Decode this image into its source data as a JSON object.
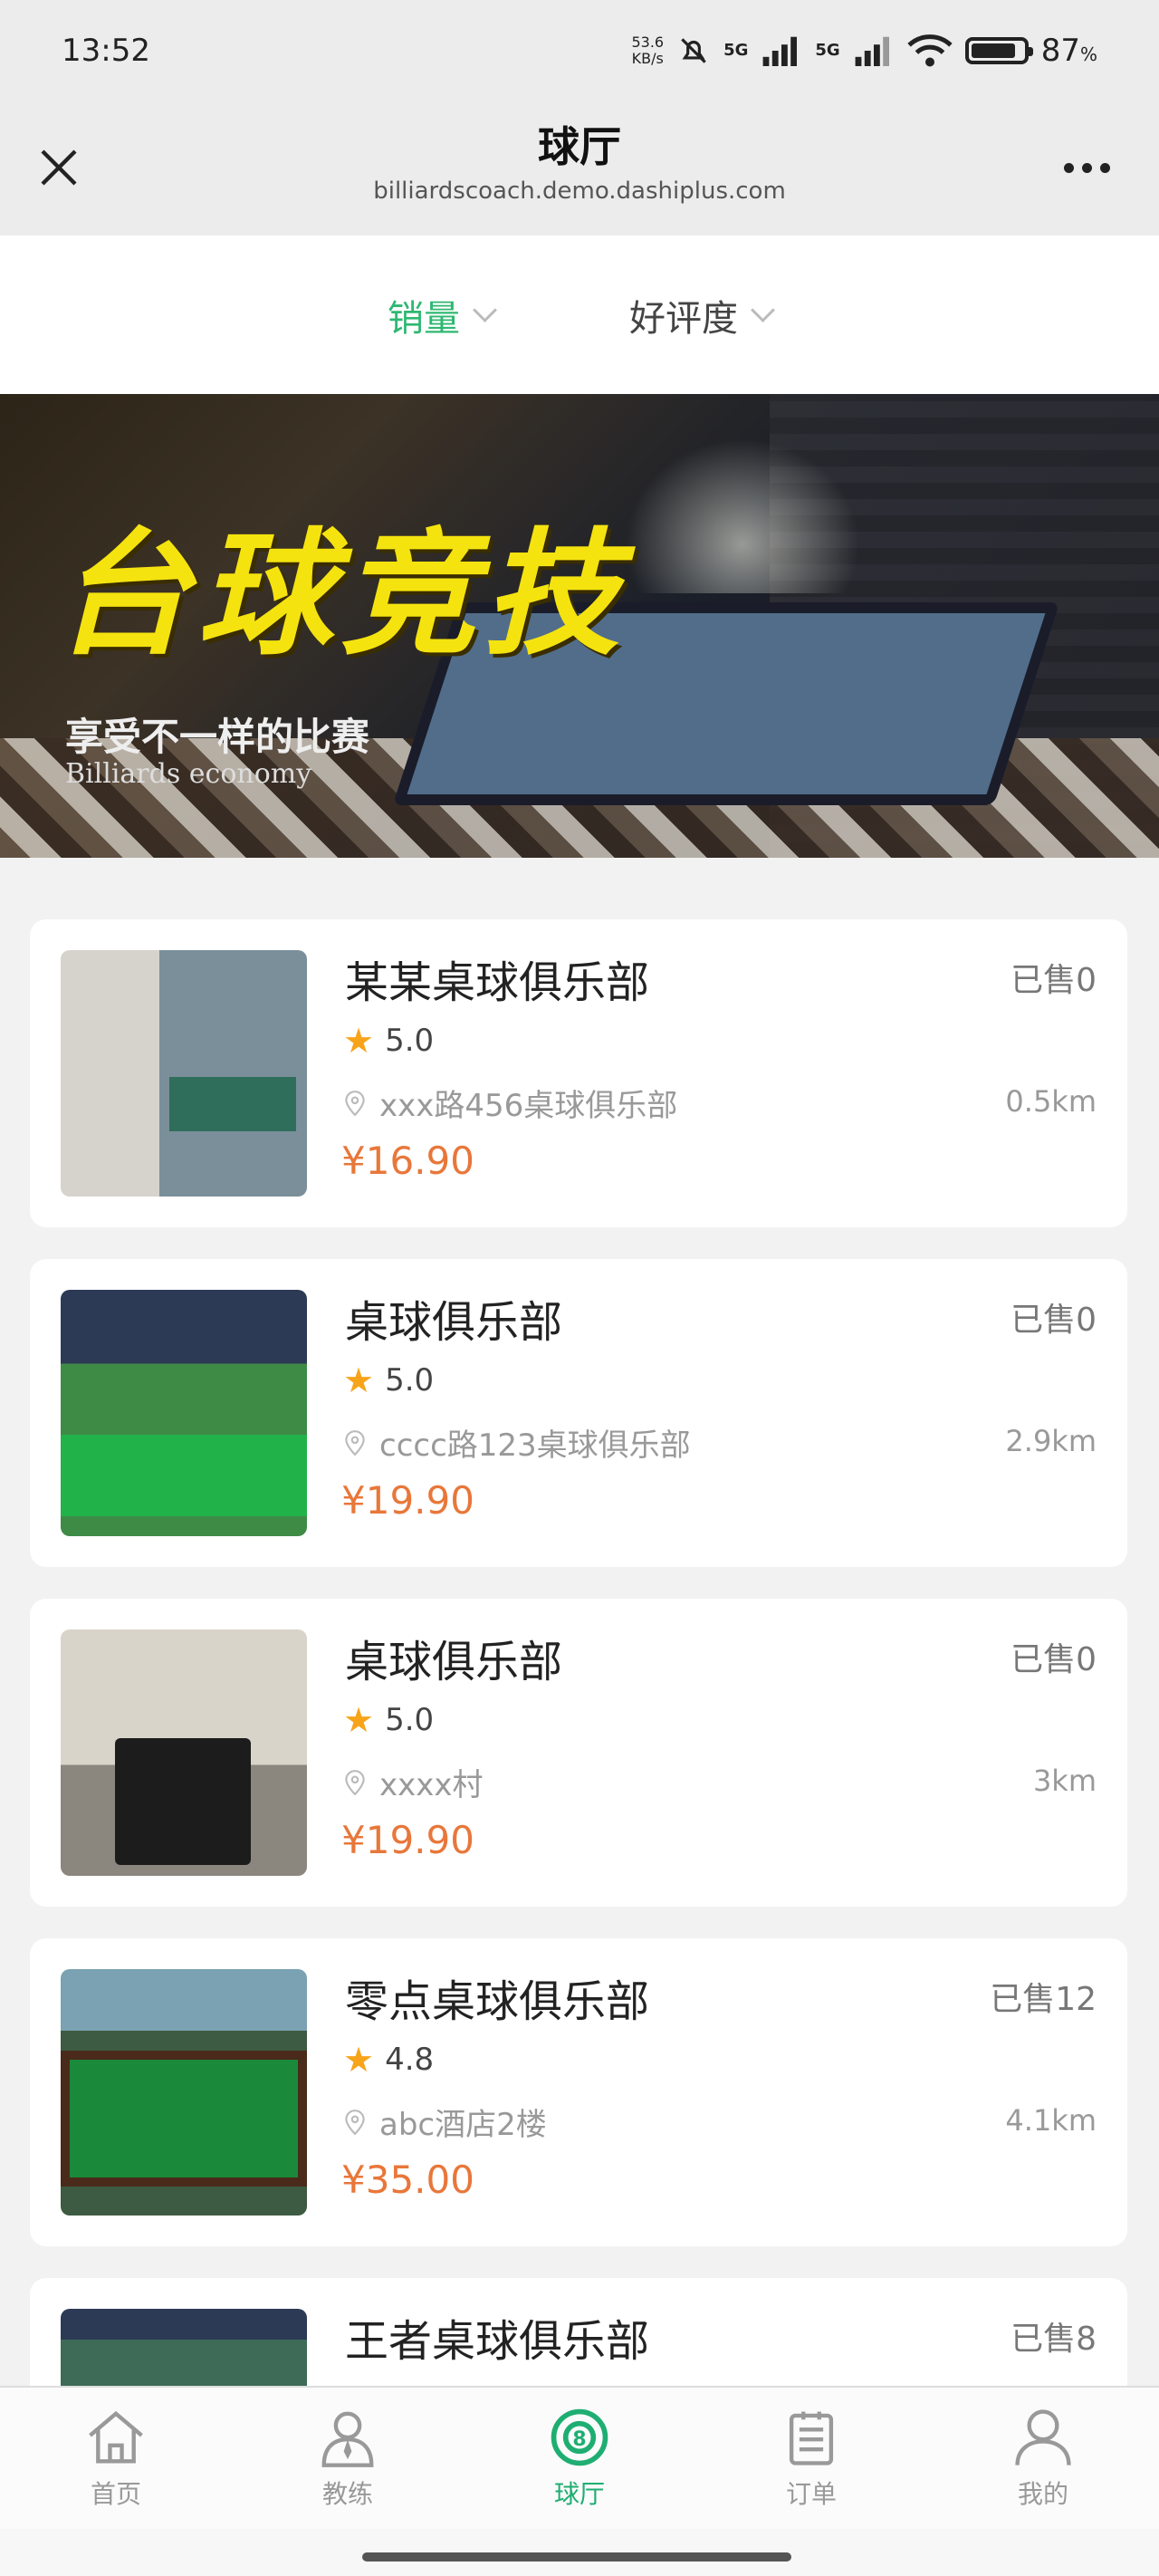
{
  "status_bar": {
    "time": "13:52",
    "net_speed_value": "53.6",
    "net_speed_unit": "KB/s",
    "signal_1": "5G",
    "signal_2": "5G",
    "battery_level": 87,
    "battery_text": "87"
  },
  "nav": {
    "title": "球厅",
    "subtitle": "billiardscoach.demo.dashiplus.com"
  },
  "filters": [
    {
      "label": "销量",
      "active": true
    },
    {
      "label": "好评度",
      "active": false
    }
  ],
  "banner": {
    "title": "台球竞技",
    "subtitle": "享受不一样的比赛",
    "subtitle_en": "Billiards economy"
  },
  "clubs": [
    {
      "name": "某某桌球俱乐部",
      "sold": "已售0",
      "rating": "5.0",
      "address": "xxx路456桌球俱乐部",
      "distance": "0.5km",
      "price": "¥16.90"
    },
    {
      "name": "桌球俱乐部",
      "sold": "已售0",
      "rating": "5.0",
      "address": "cccc路123桌球俱乐部",
      "distance": "2.9km",
      "price": "¥19.90"
    },
    {
      "name": "桌球俱乐部",
      "sold": "已售0",
      "rating": "5.0",
      "address": "xxxx村",
      "distance": "3km",
      "price": "¥19.90"
    },
    {
      "name": "零点桌球俱乐部",
      "sold": "已售12",
      "rating": "4.8",
      "address": "abc酒店2楼",
      "distance": "4.1km",
      "price": "¥35.00"
    },
    {
      "name": "王者桌球俱乐部",
      "sold": "已售8"
    }
  ],
  "tabs": [
    {
      "label": "首页",
      "icon": "home-icon"
    },
    {
      "label": "教练",
      "icon": "coach-icon"
    },
    {
      "label": "球厅",
      "icon": "billiard-ball-icon"
    },
    {
      "label": "订单",
      "icon": "order-icon"
    },
    {
      "label": "我的",
      "icon": "profile-icon"
    }
  ],
  "colors": {
    "accent": "#2fb872",
    "price": "#e8773a",
    "star": "#f7a41b"
  }
}
